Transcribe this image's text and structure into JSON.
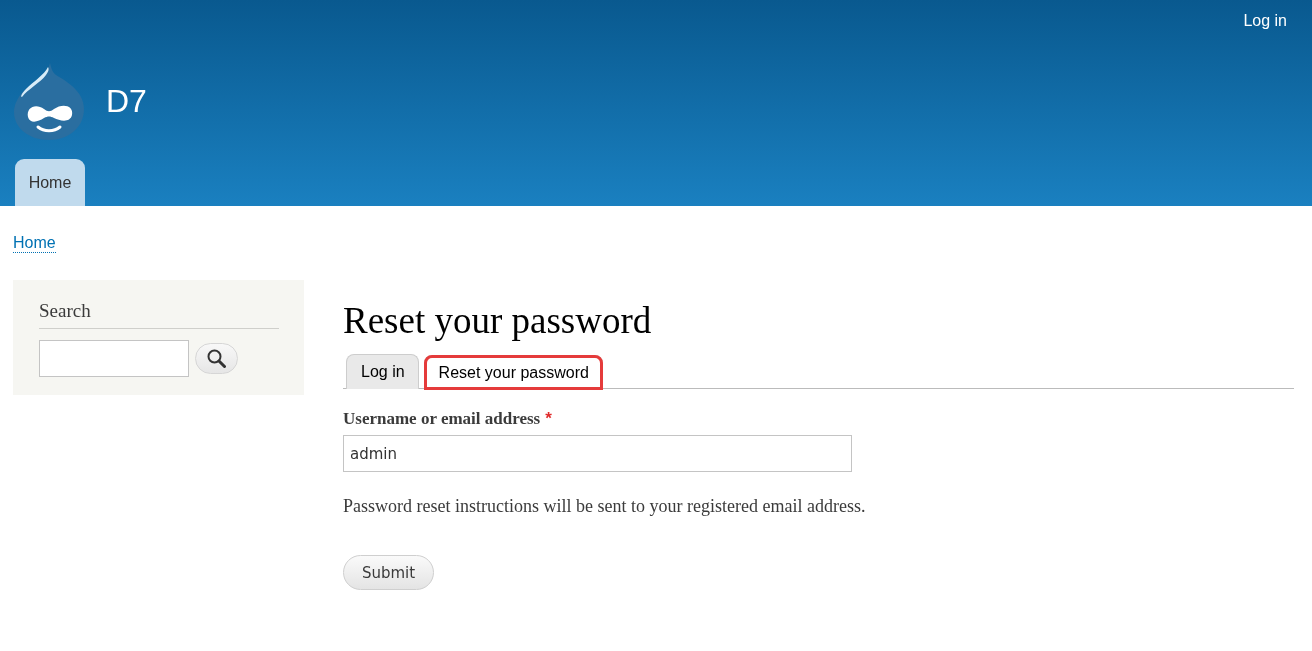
{
  "header": {
    "user_link": "Log in",
    "site_name": "D7",
    "nav": [
      {
        "label": "Home",
        "selected": true
      }
    ]
  },
  "breadcrumb": [
    {
      "label": "Home"
    }
  ],
  "sidebar": {
    "search_block": {
      "title": "Search"
    }
  },
  "main": {
    "title": "Reset your password",
    "tabs": [
      {
        "label": "Log in",
        "selected": false,
        "highlighted": false
      },
      {
        "label": "Reset your password",
        "selected": true,
        "highlighted": true
      }
    ],
    "form": {
      "field": {
        "label": "Username or email address",
        "required": true,
        "required_mark": "*",
        "value": "admin"
      },
      "description": "Password reset instructions will be sent to your registered email address.",
      "submit": "Submit"
    }
  }
}
